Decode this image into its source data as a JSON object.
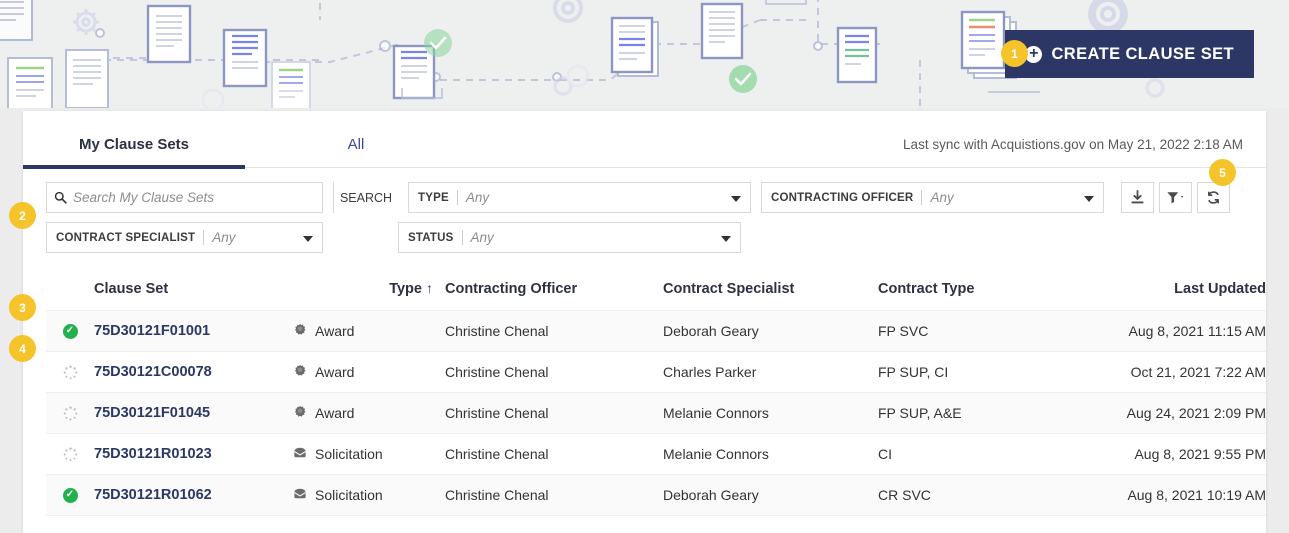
{
  "header": {
    "create_button": {
      "label": "CREATE CLAUSE SET",
      "icon": "plus-circle-icon",
      "bg_color": "#2c3766"
    },
    "badge_color": "#f5c42a"
  },
  "step_badges": [
    {
      "id": "1",
      "label": "1"
    },
    {
      "id": "2",
      "label": "2"
    },
    {
      "id": "3",
      "label": "3"
    },
    {
      "id": "4",
      "label": "4"
    },
    {
      "id": "5",
      "label": "5"
    }
  ],
  "tabs": [
    {
      "label": "My Clause Sets",
      "active": true
    },
    {
      "label": "All",
      "active": false
    }
  ],
  "sync_note": "Last sync with Acquistions.gov on May 21, 2022 2:18 AM",
  "filters": {
    "search": {
      "placeholder": "Search My Clause Sets",
      "value": "",
      "icon": "search-icon",
      "button_label": "SEARCH"
    },
    "type": {
      "label": "TYPE",
      "value": "Any"
    },
    "contracting_officer": {
      "label": "CONTRACTING OFFICER",
      "value": "Any"
    },
    "contract_specialist": {
      "label": "CONTRACT SPECIALIST",
      "value": "Any"
    },
    "status": {
      "label": "STATUS",
      "value": "Any"
    },
    "actions": [
      {
        "name": "download-icon",
        "title": "Download"
      },
      {
        "name": "filter-icon",
        "title": "Filter"
      },
      {
        "name": "refresh-icon",
        "title": "Refresh"
      }
    ]
  },
  "table": {
    "columns": [
      {
        "key": "status",
        "label": ""
      },
      {
        "key": "name",
        "label": "Clause Set"
      },
      {
        "key": "type",
        "label": "Type",
        "sorted": true,
        "sort_dir": "asc"
      },
      {
        "key": "contracting_officer",
        "label": "Contracting Officer"
      },
      {
        "key": "contract_specialist",
        "label": "Contract Specialist"
      },
      {
        "key": "contract_type",
        "label": "Contract Type"
      },
      {
        "key": "last_updated",
        "label": "Last Updated"
      }
    ],
    "rows": [
      {
        "status": "complete",
        "name": "75D30121F01001",
        "type": "Award",
        "type_icon": "award-seal-icon",
        "contracting_officer": "Christine Chenal",
        "contract_specialist": "Deborah Geary",
        "contract_type": "FP SVC",
        "last_updated": "Aug 8, 2021 11:15 AM"
      },
      {
        "status": "pending",
        "name": "75D30121C00078",
        "type": "Award",
        "type_icon": "award-seal-icon",
        "contracting_officer": "Christine Chenal",
        "contract_specialist": "Charles Parker",
        "contract_type": "FP SUP, CI",
        "last_updated": "Oct 21, 2021 7:22 AM"
      },
      {
        "status": "pending",
        "name": "75D30121F01045",
        "type": "Award",
        "type_icon": "award-seal-icon",
        "contracting_officer": "Christine Chenal",
        "contract_specialist": "Melanie Connors",
        "contract_type": "FP SUP, A&E",
        "last_updated": "Aug 24, 2021 2:09 PM"
      },
      {
        "status": "pending",
        "name": "75D30121R01023",
        "type": "Solicitation",
        "type_icon": "envelope-icon",
        "contracting_officer": "Christine Chenal",
        "contract_specialist": "Melanie Connors",
        "contract_type": "CI",
        "last_updated": "Aug 8, 2021 9:55 PM"
      },
      {
        "status": "complete",
        "name": "75D30121R01062",
        "type": "Solicitation",
        "type_icon": "envelope-icon",
        "contracting_officer": "Christine Chenal",
        "contract_specialist": "Deborah Geary",
        "contract_type": "CR SVC",
        "last_updated": "Aug 8, 2021 10:19 AM"
      }
    ]
  }
}
